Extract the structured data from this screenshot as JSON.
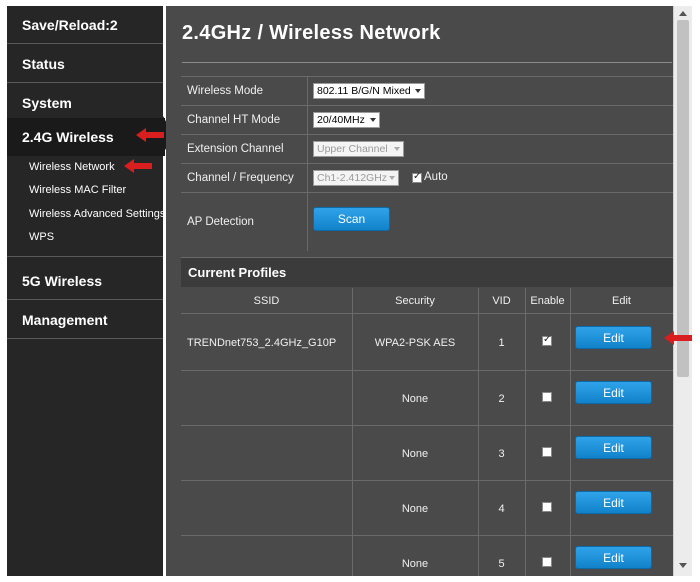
{
  "sidebar": {
    "items": [
      {
        "label": "Save/Reload:2"
      },
      {
        "label": "Status"
      },
      {
        "label": "System"
      },
      {
        "label": "2.4G Wireless"
      },
      {
        "label": "5G Wireless"
      },
      {
        "label": "Management"
      }
    ],
    "subitems": [
      {
        "label": "Wireless Network"
      },
      {
        "label": "Wireless MAC Filter"
      },
      {
        "label": "Wireless Advanced Settings"
      },
      {
        "label": "WPS"
      }
    ]
  },
  "page": {
    "title": "2.4GHz / Wireless Network"
  },
  "settings": {
    "wireless_mode": {
      "label": "Wireless Mode",
      "value": "802.11 B/G/N Mixed"
    },
    "channel_ht_mode": {
      "label": "Channel HT Mode",
      "value": "20/40MHz"
    },
    "extension_channel": {
      "label": "Extension Channel",
      "value": "Upper Channel"
    },
    "channel_frequency": {
      "label": "Channel / Frequency",
      "value": "Ch1-2.412GHz",
      "auto_label": "Auto",
      "auto_checked": true
    },
    "ap_detection": {
      "label": "AP Detection",
      "button": "Scan"
    }
  },
  "profiles": {
    "title": "Current Profiles",
    "columns": [
      "SSID",
      "Security",
      "VID",
      "Enable",
      "Edit"
    ],
    "rows": [
      {
        "ssid": "TRENDnet753_2.4GHz_G10P",
        "security": "WPA2-PSK AES",
        "vid": "1",
        "enabled": true,
        "edit": "Edit"
      },
      {
        "ssid": "",
        "security": "None",
        "vid": "2",
        "enabled": false,
        "edit": "Edit"
      },
      {
        "ssid": "",
        "security": "None",
        "vid": "3",
        "enabled": false,
        "edit": "Edit"
      },
      {
        "ssid": "",
        "security": "None",
        "vid": "4",
        "enabled": false,
        "edit": "Edit"
      },
      {
        "ssid": "",
        "security": "None",
        "vid": "5",
        "enabled": false,
        "edit": "Edit"
      }
    ]
  },
  "colors": {
    "sidebar_bg": "#262626",
    "content_bg": "#4a4a4a",
    "button_blue": "#1a8fd8",
    "annotation_red": "#d81e1e"
  }
}
